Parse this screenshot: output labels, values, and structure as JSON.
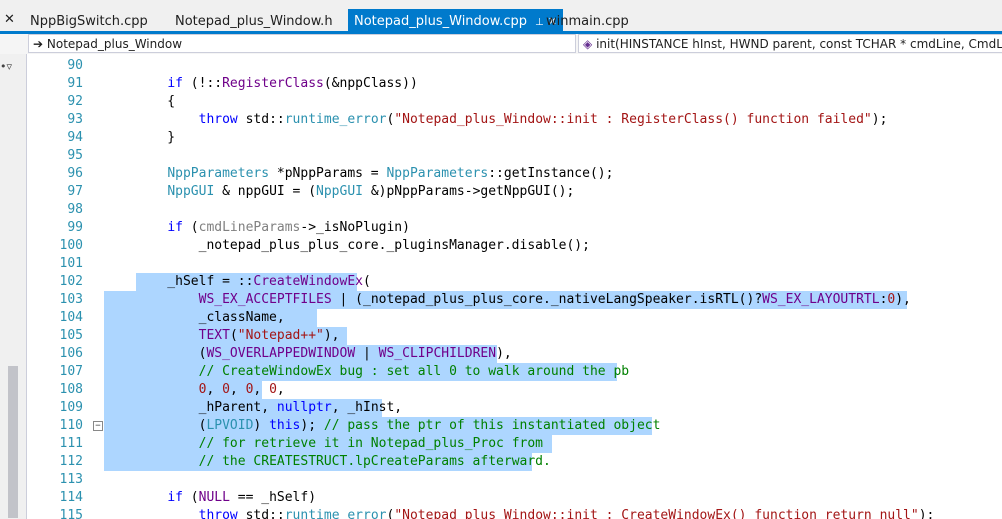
{
  "window": {
    "close_glyph": "✕"
  },
  "tabs": [
    {
      "label": "NppBigSwitch.cpp",
      "active": false
    },
    {
      "label": "Notepad_plus_Window.h",
      "active": false
    },
    {
      "label": "Notepad_plus_Window.cpp",
      "active": true
    },
    {
      "label": "winmain.cpp",
      "active": false
    }
  ],
  "active_tab_pin_glyph": "⊥",
  "active_tab_close_glyph": "✕",
  "navbar": {
    "scope": "Notepad_plus_Window",
    "member": "init(HINSTANCE hInst, HWND parent, const TCHAR * cmdLine, CmdLinePara"
  },
  "colors": {
    "selection": "#add6ff",
    "line_number": "#2b91af",
    "keyword": "#0000ff",
    "type": "#2b91af",
    "string": "#a31515",
    "comment": "#008000",
    "macro": "#6f008a",
    "param": "#808080",
    "tab_active": "#007acc"
  },
  "code_lines": [
    {
      "n": "90",
      "tokens": []
    },
    {
      "n": "91",
      "tokens": [
        [
          "    ",
          ""
        ],
        [
          "if",
          "k"
        ],
        [
          " (!::",
          ""
        ],
        [
          "RegisterClass",
          "m"
        ],
        [
          "(&nppClass))",
          ""
        ]
      ]
    },
    {
      "n": "92",
      "tokens": [
        [
          "    {",
          ""
        ]
      ]
    },
    {
      "n": "93",
      "tokens": [
        [
          "        ",
          ""
        ],
        [
          "throw",
          "k"
        ],
        [
          " std::",
          ""
        ],
        [
          "runtime_error",
          "t"
        ],
        [
          "(",
          ""
        ],
        [
          "\"Notepad_plus_Window::init : RegisterClass() function failed\"",
          "s"
        ],
        [
          ");",
          ""
        ]
      ]
    },
    {
      "n": "94",
      "tokens": [
        [
          "    }",
          ""
        ]
      ]
    },
    {
      "n": "95",
      "tokens": []
    },
    {
      "n": "96",
      "tokens": [
        [
          "    ",
          ""
        ],
        [
          "NppParameters",
          "t"
        ],
        [
          " *pNppParams = ",
          ""
        ],
        [
          "NppParameters",
          "t"
        ],
        [
          "::getInstance();",
          ""
        ]
      ]
    },
    {
      "n": "97",
      "tokens": [
        [
          "    ",
          ""
        ],
        [
          "NppGUI",
          "t"
        ],
        [
          " & nppGUI = (",
          ""
        ],
        [
          "NppGUI",
          "t"
        ],
        [
          " &)pNppParams->getNppGUI();",
          ""
        ]
      ]
    },
    {
      "n": "98",
      "tokens": []
    },
    {
      "n": "99",
      "tokens": [
        [
          "    ",
          ""
        ],
        [
          "if",
          "k"
        ],
        [
          " (",
          ""
        ],
        [
          "cmdLineParams",
          "p"
        ],
        [
          "->_isNoPlugin)",
          ""
        ]
      ]
    },
    {
      "n": "100",
      "tokens": [
        [
          "        _notepad_plus_plus_core._pluginsManager.disable();",
          ""
        ]
      ]
    },
    {
      "n": "101",
      "tokens": []
    },
    {
      "n": "102",
      "tokens": [
        [
          "    _hSelf = ::",
          ""
        ],
        [
          "CreateWindowEx",
          "m"
        ],
        [
          "(",
          ""
        ]
      ]
    },
    {
      "n": "103",
      "tokens": [
        [
          "        ",
          ""
        ],
        [
          "WS_EX_ACCEPTFILES",
          "m"
        ],
        [
          " | (_notepad_plus_plus_core._nativeLangSpeaker.isRTL()?",
          ""
        ],
        [
          "WS_EX_LAYOUTRTL",
          "m"
        ],
        [
          ":",
          ""
        ],
        [
          "0",
          "s"
        ],
        [
          "),",
          ""
        ]
      ]
    },
    {
      "n": "104",
      "tokens": [
        [
          "        _className,",
          ""
        ]
      ]
    },
    {
      "n": "105",
      "tokens": [
        [
          "        ",
          ""
        ],
        [
          "TEXT",
          "m"
        ],
        [
          "(",
          ""
        ],
        [
          "\"Notepad++\"",
          "s"
        ],
        [
          "),",
          ""
        ]
      ]
    },
    {
      "n": "106",
      "tokens": [
        [
          "        (",
          ""
        ],
        [
          "WS_OVERLAPPEDWINDOW",
          "m"
        ],
        [
          " | ",
          ""
        ],
        [
          "WS_CLIPCHILDREN",
          "m"
        ],
        [
          "),",
          ""
        ]
      ]
    },
    {
      "n": "107",
      "tokens": [
        [
          "        ",
          ""
        ],
        [
          "// CreateWindowEx bug : set all 0 to walk around the pb",
          "c"
        ]
      ]
    },
    {
      "n": "108",
      "tokens": [
        [
          "        ",
          ""
        ],
        [
          "0",
          "s"
        ],
        [
          ", ",
          ""
        ],
        [
          "0",
          "s"
        ],
        [
          ", ",
          ""
        ],
        [
          "0",
          "s"
        ],
        [
          ", ",
          ""
        ],
        [
          "0",
          "s"
        ],
        [
          ",",
          ""
        ]
      ]
    },
    {
      "n": "109",
      "tokens": [
        [
          "        _hParent, ",
          ""
        ],
        [
          "nullptr",
          "k"
        ],
        [
          ", _hInst,",
          ""
        ]
      ]
    },
    {
      "n": "110",
      "tokens": [
        [
          "        (",
          ""
        ],
        [
          "LPVOID",
          "t"
        ],
        [
          ") ",
          ""
        ],
        [
          "this",
          "k"
        ],
        [
          "); ",
          ""
        ],
        [
          "// pass the ptr of this instantiated object",
          "c"
        ]
      ]
    },
    {
      "n": "111",
      "tokens": [
        [
          "        ",
          ""
        ],
        [
          "// for retrieve it in Notepad_plus_Proc from",
          "c"
        ]
      ]
    },
    {
      "n": "112",
      "tokens": [
        [
          "        ",
          ""
        ],
        [
          "// the CREATESTRUCT.lpCreateParams afterward.",
          "c"
        ]
      ]
    },
    {
      "n": "113",
      "tokens": []
    },
    {
      "n": "114",
      "tokens": [
        [
          "    ",
          ""
        ],
        [
          "if",
          "k"
        ],
        [
          " (",
          ""
        ],
        [
          "NULL",
          "m"
        ],
        [
          " == _hSelf)",
          ""
        ]
      ]
    },
    {
      "n": "115",
      "tokens": [
        [
          "        ",
          ""
        ],
        [
          "throw",
          "k"
        ],
        [
          " std::",
          ""
        ],
        [
          "runtime_error",
          "t"
        ],
        [
          "(",
          ""
        ],
        [
          "\"Notepad_plus_Window::init : CreateWindowEx() function return null\"",
          "s"
        ],
        [
          ");",
          ""
        ]
      ]
    }
  ]
}
